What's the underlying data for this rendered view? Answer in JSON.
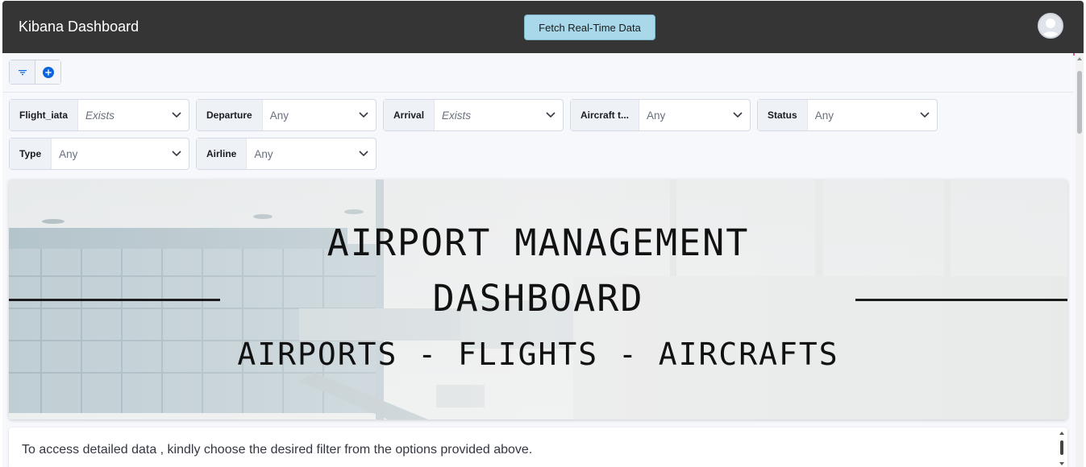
{
  "header": {
    "title": "Kibana Dashboard",
    "fetch_button": "Fetch Real-Time Data",
    "avatar_icon": "user-avatar-icon"
  },
  "toolbar": {
    "filter_icon": "filter-icon",
    "add_icon": "add-circle-icon"
  },
  "controls": [
    {
      "label": "Flight_iata",
      "value": "Exists"
    },
    {
      "label": "Departure",
      "value": "Any"
    },
    {
      "label": "Arrival",
      "value": "Exists"
    },
    {
      "label": "Aircraft t...",
      "value": "Any"
    },
    {
      "label": "Status",
      "value": "Any"
    },
    {
      "label": "Type",
      "value": "Any"
    },
    {
      "label": "Airline",
      "value": "Any"
    }
  ],
  "banner": {
    "title_line1": "AIRPORT MANAGEMENT",
    "title_line2": "DASHBOARD",
    "subtitle": "AIRPORTS - FLIGHTS - AIRCRAFTS"
  },
  "note": {
    "text": "To access detailed data , kindly choose the desired filter from the options provided above."
  },
  "colors": {
    "header_bg": "#353535",
    "fetch_button_bg": "#a8d8ea",
    "canvas_bg": "#f7f8fc",
    "accent_add": "#0b64dd"
  }
}
